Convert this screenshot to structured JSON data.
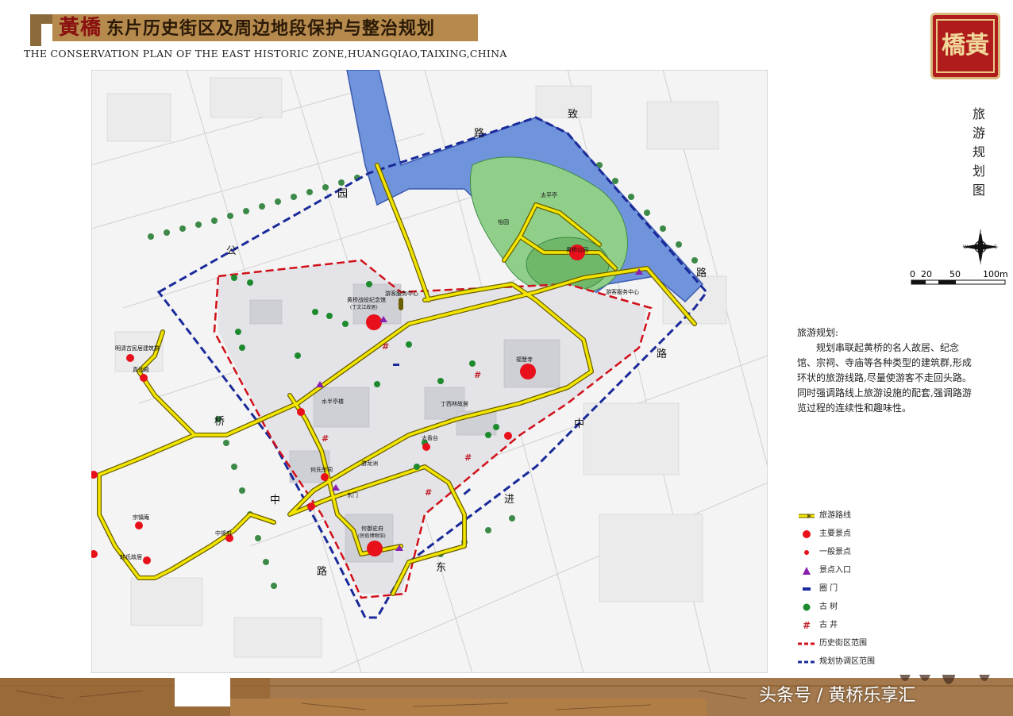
{
  "header": {
    "brand": "黃橋",
    "title": "东片历史街区及周边地段保护与整治规划",
    "subtitle_en": "THE CONSERVATION PLAN OF THE EAST HISTORIC ZONE,HUANGQIAO,TAIXING,CHINA"
  },
  "seal": {
    "chars": [
      "橋",
      "黃"
    ]
  },
  "side_title": "旅游规划图",
  "compass": {
    "n": "N",
    "s": "S",
    "w": "W",
    "e": "E"
  },
  "scale": {
    "labels": [
      "0",
      "20",
      "50",
      "100m"
    ]
  },
  "description": {
    "heading": "旅游规划:",
    "body": "规划串联起黄桥的名人故居、纪念馆、宗祠、寺庙等各种类型的建筑群,形成环状的旅游线路,尽量使游客不走回头路。同时强调路线上旅游设施的配套,强调路游览过程的连续性和趣味性。"
  },
  "legend": [
    {
      "label": "旅游路线",
      "icon": "route-arrow"
    },
    {
      "label": "主要景点",
      "icon": "major-attraction-dot"
    },
    {
      "label": "一般景点",
      "icon": "minor-attraction-dot"
    },
    {
      "label": "景点入口",
      "icon": "entrance-triangle"
    },
    {
      "label": "圈 门",
      "icon": "gate-bar"
    },
    {
      "label": "古 树",
      "icon": "ancient-tree-dot"
    },
    {
      "label": "古 井",
      "icon": "ancient-well-hash"
    },
    {
      "label": "历史街区范围",
      "icon": "historic-boundary-red-dash"
    },
    {
      "label": "规划协调区范围",
      "icon": "coordination-boundary-blue-dash"
    }
  ],
  "map_labels": {
    "gongyuan": "黄桥公园",
    "fuhuisi": "福慧寺",
    "jinianguan": "黄桥战役纪念馆",
    "jinianguan_sub": "(丁文江故居)",
    "hejuhouse": "何御史府",
    "hejuhouse_sub": "(民俗博物馆)",
    "mingqing": "明清古民居建筑群",
    "zhenwudian": "真武殿",
    "zongjiaan": "宗镇庵",
    "hanshi": "韩氏故居",
    "zhongjiangfu": "中将府",
    "hoshi": "何氏宗祠",
    "taiqiting": "太香台",
    "dingxijiang": "丁西林故居",
    "yuke1": "游客服务中心",
    "yuke2": "游客服务中心",
    "shuiyun": "水半亭楼",
    "road_qiao": "桥",
    "road_zhong": "中",
    "road_lu": "路",
    "road_jin": "进",
    "road_dong": "东",
    "road_gong": "公",
    "road_yuan": "园",
    "road_lu2": "路",
    "road_jiu": "致",
    "road_lu3": "路",
    "road_zhong2": "中",
    "road_lu4": "路",
    "yiyuan": "怡园",
    "tailulou": "太平亭",
    "dongting": "东门",
    "youlongju": "游龙洲"
  },
  "colors": {
    "route": "#f2e600",
    "route_edge": "#8a7d00",
    "major": "#e8101a",
    "tree": "#1e8a2e",
    "well": "#c0202a",
    "historic_boundary": "#d0101a",
    "coord_boundary": "#1a2a9a",
    "water": "#6f8fd8",
    "footer": "#9a6a3a"
  },
  "watermark": "头条号 / 黄桥乐享汇"
}
